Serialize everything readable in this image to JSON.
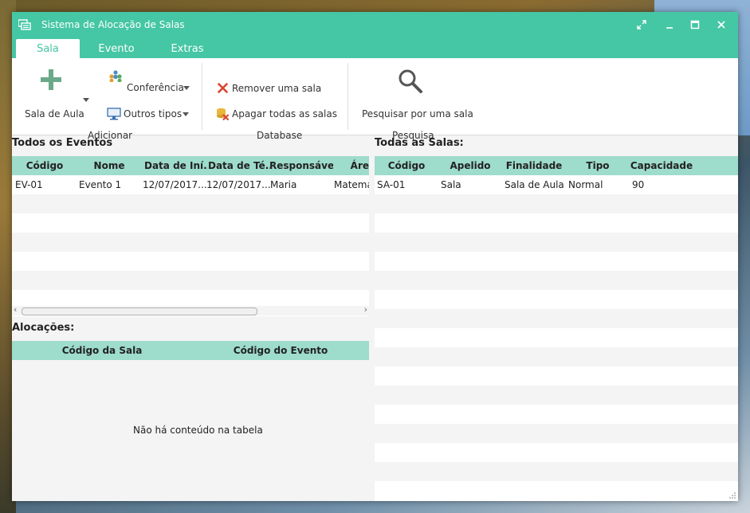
{
  "window": {
    "title": "Sistema de Alocação de Salas",
    "controls": [
      "restore-icon",
      "minimize-icon",
      "maximize-icon",
      "close-icon"
    ]
  },
  "tabs": [
    {
      "label": "Sala",
      "active": true
    },
    {
      "label": "Evento",
      "active": false
    },
    {
      "label": "Extras",
      "active": false
    }
  ],
  "ribbon": {
    "adicionar": {
      "main_label": "Sala de Aula",
      "conferencia_label": "Conferência",
      "outros_label": "Outros tipos",
      "group_label": "Adicionar"
    },
    "database": {
      "remover_label": "Remover uma sala",
      "apagar_label": "Apagar todas as salas",
      "group_label": "Database"
    },
    "pesquisa": {
      "pesquisar_label": "Pesquisar por uma sala",
      "group_label": "Pesquisa"
    }
  },
  "eventos": {
    "title": "Todos os Eventos",
    "columns": [
      "Código",
      "Nome",
      "Data de Iní...",
      "Data de Té...",
      "Responsável",
      "Áre"
    ],
    "rows": [
      [
        "EV-01",
        "Evento 1",
        "12/07/2017...",
        "12/07/2017...",
        "Maria",
        "Matemá"
      ]
    ]
  },
  "alocacoes": {
    "title": "Alocações:",
    "columns": [
      "Código da Sala",
      "Código do Evento"
    ],
    "empty_message": "Não há conteúdo na tabela"
  },
  "salas": {
    "title": "Todas as Salas:",
    "columns": [
      "Código",
      "Apelido",
      "Finalidade",
      "Tipo",
      "Capacidade"
    ],
    "rows": [
      [
        "SA-01",
        "Sala",
        "Sala de Aula",
        "Normal",
        "90"
      ]
    ]
  },
  "colors": {
    "accent": "#45c6a4",
    "table_header": "#9edccb"
  }
}
